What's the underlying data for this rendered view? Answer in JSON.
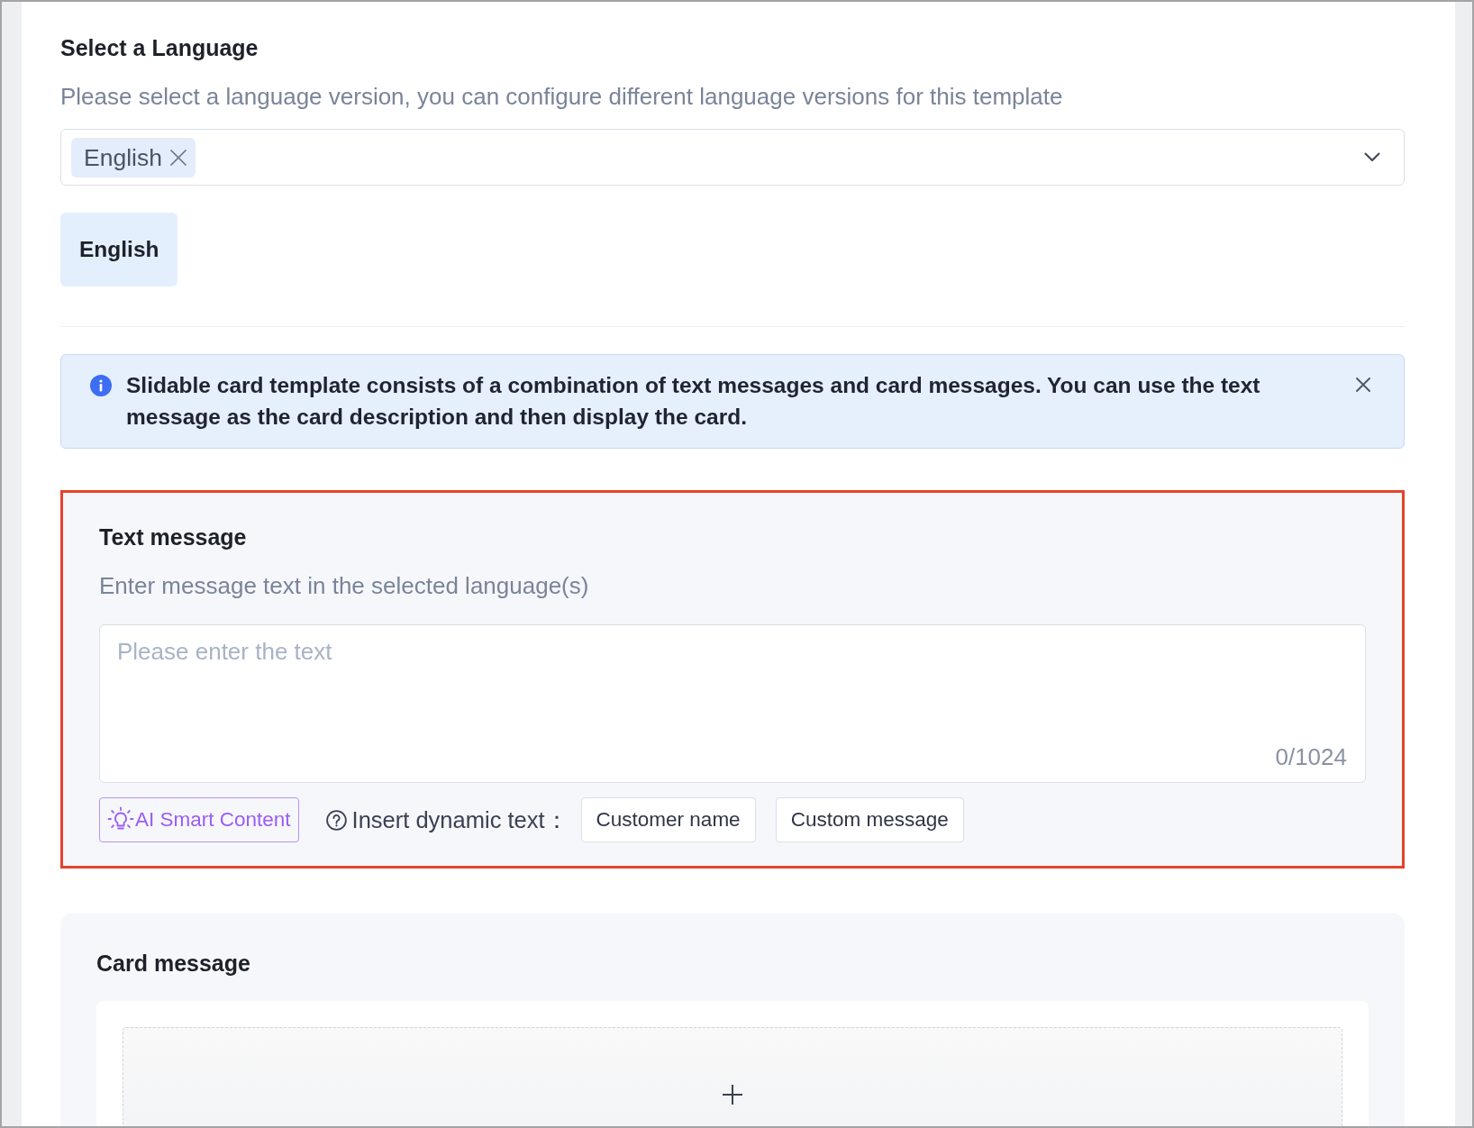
{
  "language_section": {
    "title": "Select a Language",
    "description": "Please select a language version, you can configure different language versions for this template",
    "select": {
      "tags": [
        {
          "label": "English"
        }
      ]
    },
    "language_tabs": [
      {
        "label": "English",
        "selected": true
      }
    ]
  },
  "notice": {
    "text": "Slidable card template consists of a combination of text messages and card messages. You can use the text message as the card description and then display the card."
  },
  "text_message": {
    "highlighted": true,
    "title": "Text message",
    "description": "Enter message text in the selected language(s)",
    "input": {
      "placeholder": "Please enter the text",
      "counter": "0/1024"
    },
    "ai_button": "AI Smart Content",
    "dynamic_text": {
      "label": "Insert dynamic text：",
      "options": [
        "Customer name",
        "Custom message"
      ]
    }
  },
  "card_message": {
    "title": "Card message"
  }
}
